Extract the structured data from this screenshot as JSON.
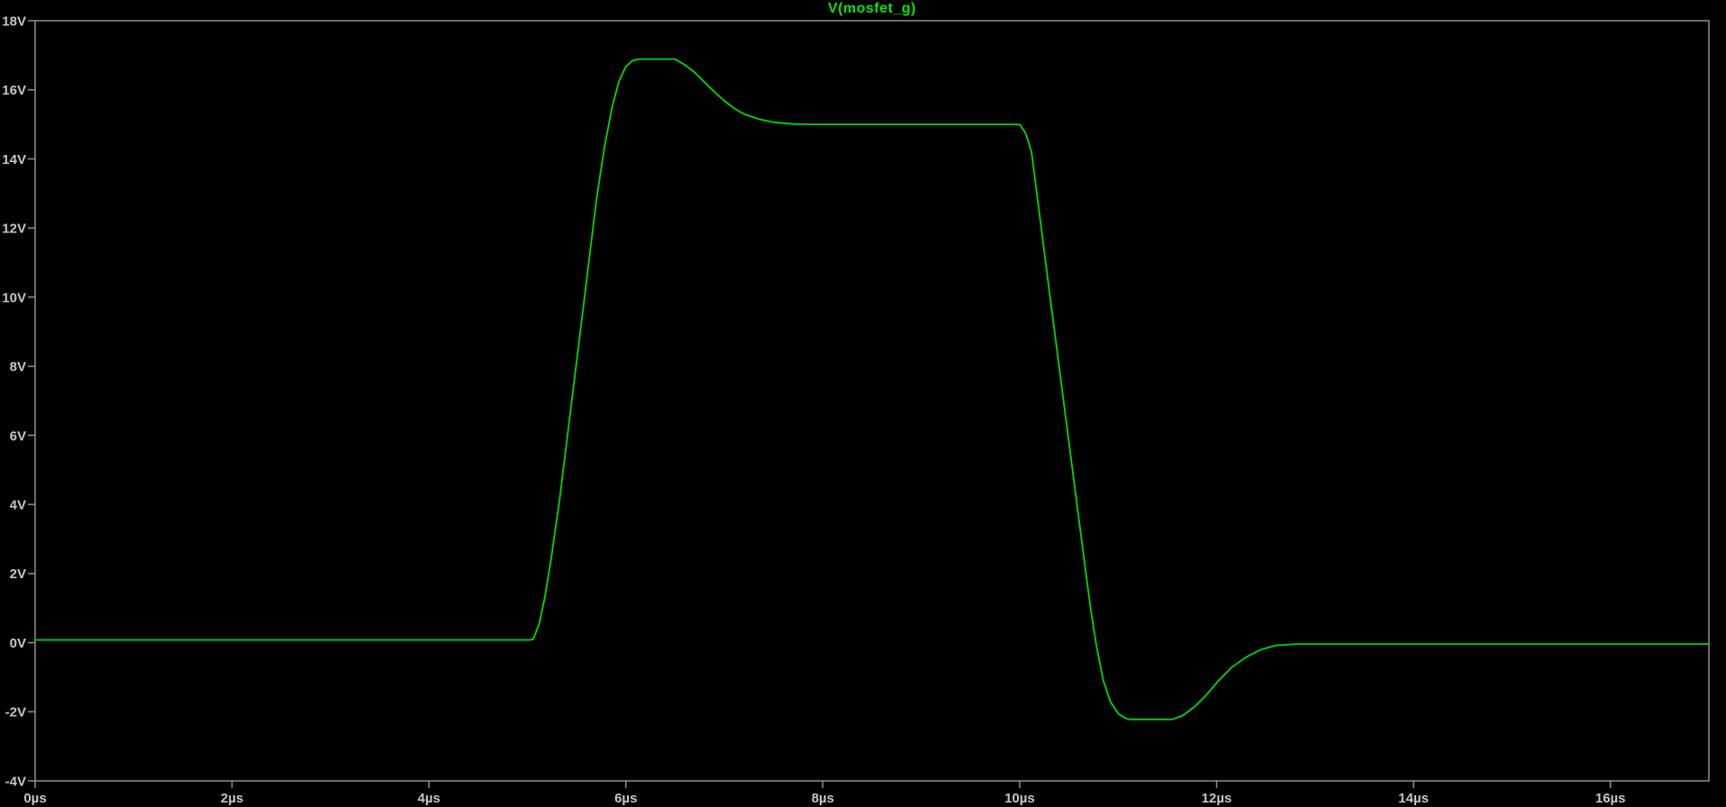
{
  "window": {
    "background_color": "#000000"
  },
  "chart_data": {
    "type": "line",
    "title": "V(mosfet_g)",
    "title_color": "#00e800",
    "axis_color": "#8f8f8f",
    "label_color": "#c6c6c6",
    "background": "#000000",
    "grid": false,
    "legend_position": "top-center",
    "x_unit": "µs",
    "y_unit": "V",
    "xlim": [
      0,
      17
    ],
    "ylim": [
      -4,
      18
    ],
    "x_ticks": {
      "values": [
        0,
        2,
        4,
        6,
        8,
        10,
        12,
        14,
        16
      ],
      "labels": [
        "0µs",
        "2µs",
        "4µs",
        "6µs",
        "8µs",
        "10µs",
        "12µs",
        "14µs",
        "16µs"
      ]
    },
    "y_ticks": {
      "values": [
        18,
        16,
        14,
        12,
        10,
        8,
        6,
        4,
        2,
        0,
        -2,
        -4
      ],
      "labels": [
        "18V",
        "16V",
        "14V",
        "12V",
        "10V",
        "8V",
        "6V",
        "4V",
        "2V",
        "0V",
        "-2V",
        "-4V"
      ]
    },
    "series": [
      {
        "name": "V(mosfet_g)",
        "color": "#00d800",
        "points": [
          [
            0.0,
            0.08
          ],
          [
            5.02,
            0.08
          ],
          [
            5.06,
            0.1
          ],
          [
            5.12,
            0.55
          ],
          [
            5.18,
            1.35
          ],
          [
            5.25,
            2.6
          ],
          [
            5.33,
            4.2
          ],
          [
            5.45,
            7.0
          ],
          [
            5.58,
            10.0
          ],
          [
            5.7,
            12.8
          ],
          [
            5.78,
            14.3
          ],
          [
            5.86,
            15.5
          ],
          [
            5.93,
            16.25
          ],
          [
            6.0,
            16.67
          ],
          [
            6.07,
            16.85
          ],
          [
            6.14,
            16.89
          ],
          [
            6.5,
            16.89
          ],
          [
            6.6,
            16.72
          ],
          [
            6.7,
            16.5
          ],
          [
            6.8,
            16.22
          ],
          [
            6.9,
            15.94
          ],
          [
            7.0,
            15.68
          ],
          [
            7.1,
            15.46
          ],
          [
            7.2,
            15.3
          ],
          [
            7.35,
            15.15
          ],
          [
            7.5,
            15.06
          ],
          [
            7.7,
            15.01
          ],
          [
            7.9,
            15.0
          ],
          [
            10.0,
            15.0
          ],
          [
            10.06,
            14.75
          ],
          [
            10.12,
            14.2
          ],
          [
            10.3,
            10.2
          ],
          [
            10.5,
            5.8
          ],
          [
            10.65,
            2.5
          ],
          [
            10.72,
            1.0
          ],
          [
            10.78,
            -0.1
          ],
          [
            10.85,
            -1.1
          ],
          [
            10.92,
            -1.7
          ],
          [
            11.0,
            -2.05
          ],
          [
            11.08,
            -2.2
          ],
          [
            11.12,
            -2.22
          ],
          [
            11.55,
            -2.22
          ],
          [
            11.65,
            -2.12
          ],
          [
            11.78,
            -1.85
          ],
          [
            11.9,
            -1.5
          ],
          [
            12.02,
            -1.1
          ],
          [
            12.15,
            -0.72
          ],
          [
            12.3,
            -0.42
          ],
          [
            12.45,
            -0.2
          ],
          [
            12.6,
            -0.08
          ],
          [
            12.8,
            -0.04
          ],
          [
            13.2,
            -0.04
          ],
          [
            17.0,
            -0.04
          ]
        ]
      }
    ]
  }
}
